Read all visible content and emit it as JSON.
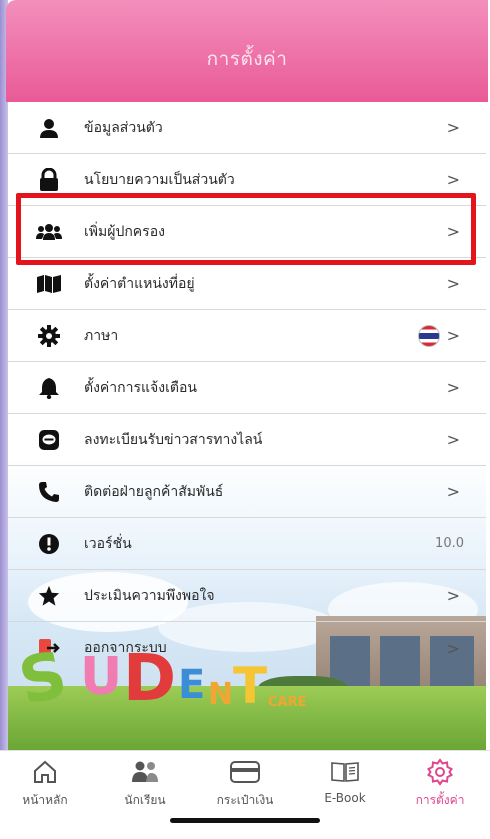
{
  "header": {
    "title": "การตั้งค่า"
  },
  "menu": [
    {
      "label": "ข้อมูลส่วนตัว",
      "icon": "person-icon",
      "chevron": ">"
    },
    {
      "label": "นโยบายความเป็นส่วนตัว",
      "icon": "lock-icon",
      "chevron": ">"
    },
    {
      "label": "เพิ่มผู้ปกครอง",
      "icon": "users-icon",
      "chevron": ">"
    },
    {
      "label": "ตั้งค่าตำแหน่งที่อยู่",
      "icon": "map-icon",
      "chevron": ">"
    },
    {
      "label": "ภาษา",
      "icon": "gear-icon",
      "chevron": ">",
      "flag": "thai-flag-icon"
    },
    {
      "label": "ตั้งค่าการแจ้งเตือน",
      "icon": "bell-icon",
      "chevron": ">"
    },
    {
      "label": "ลงทะเบียนรับข่าวสารทางไลน์",
      "icon": "line-chat-icon",
      "chevron": ">"
    },
    {
      "label": "ติดต่อฝ่ายลูกค้าสัมพันธ์",
      "icon": "phone-icon",
      "chevron": ">"
    },
    {
      "label": "เวอร์ชั่น",
      "icon": "info-icon",
      "value": "10.0"
    },
    {
      "label": "ประเมินความพึงพอใจ",
      "icon": "star-icon",
      "chevron": ">"
    },
    {
      "label": "ออกจากระบบ",
      "icon": "logout-icon",
      "chevron": ">"
    }
  ],
  "logo": {
    "letters": [
      "S",
      "U",
      "D",
      "E",
      "N",
      "T"
    ],
    "small": "CARE"
  },
  "tabs": [
    {
      "label": "หน้าหลัก",
      "icon": "home-icon"
    },
    {
      "label": "นักเรียน",
      "icon": "students-icon"
    },
    {
      "label": "กระเป๋าเงิน",
      "icon": "wallet-icon"
    },
    {
      "label": "E-Book",
      "icon": "book-icon"
    },
    {
      "label": "การตั้งค่า",
      "icon": "settings-icon",
      "active": true
    }
  ],
  "colors": {
    "accent": "#e95a97",
    "highlight": "#e3141b"
  }
}
